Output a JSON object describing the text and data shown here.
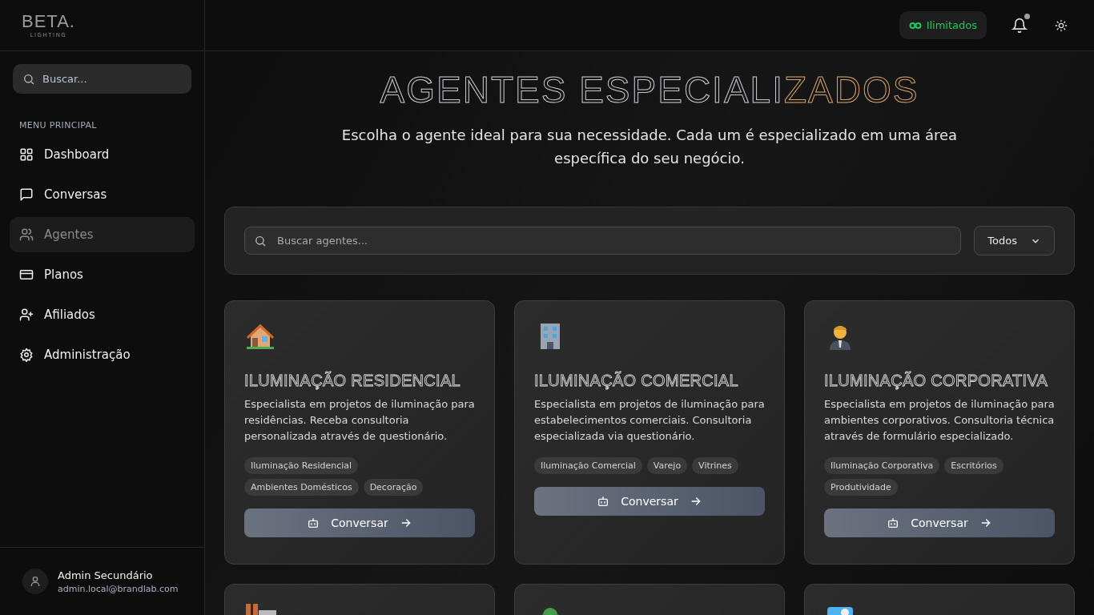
{
  "brand": {
    "logo": "BETA.",
    "tagline": "LIGHTING"
  },
  "sidebar": {
    "search": {
      "placeholder": "Buscar..."
    },
    "section_label": "MENU PRINCIPAL",
    "items": [
      {
        "label": "Dashboard",
        "kind": "grid",
        "selected": false
      },
      {
        "label": "Conversas",
        "kind": "chat",
        "selected": false
      },
      {
        "label": "Agentes",
        "kind": "users",
        "selected": true
      },
      {
        "label": "Planos",
        "kind": "card",
        "selected": false
      },
      {
        "label": "Afiliados",
        "kind": "useradd",
        "selected": false
      },
      {
        "label": "Administração",
        "kind": "gear",
        "selected": false
      }
    ],
    "user": {
      "name": "Admin Secundário",
      "email": "admin.local@brandlab.com"
    }
  },
  "header": {
    "plan_badge": "Ilimitados",
    "notification_dot": true
  },
  "page": {
    "title_start": "AGENTES ESPECIALI",
    "title_end": "ZADOS",
    "subtitle": "Escolha o agente ideal para sua necessidade. Cada um é especializado em uma área específica do seu negócio."
  },
  "filters": {
    "search": {
      "placeholder": "Buscar agentes..."
    },
    "category": "Todos"
  },
  "agents": [
    {
      "kind": "house",
      "title": "ILUMINAÇÃO RESIDENCIAL",
      "description": "Especialista em projetos de iluminação para residências. Receba consultoria personalizada através de questionário.",
      "tags": [
        "Iluminação Residencial",
        "Ambientes Domésticos",
        "Decoração"
      ],
      "button": "Conversar"
    },
    {
      "kind": "building",
      "title": "ILUMINAÇÃO COMERCIAL",
      "description": "Especialista em projetos de iluminação para estabelecimentos comerciais. Consultoria especializada via questionário.",
      "tags": [
        "Iluminação Comercial",
        "Varejo",
        "Vitrines"
      ],
      "button": "Conversar"
    },
    {
      "kind": "person",
      "title": "ILUMINAÇÃO CORPORATIVA",
      "description": "Especialista em projetos de iluminação para ambientes corporativos. Consultoria técnica através de formulário especializado.",
      "tags": [
        "Iluminação Corporativa",
        "Escritórios",
        "Produtividade"
      ],
      "button": "Conversar"
    },
    {
      "kind": "factory"
    },
    {
      "kind": "tree"
    },
    {
      "kind": "scenery"
    }
  ]
}
